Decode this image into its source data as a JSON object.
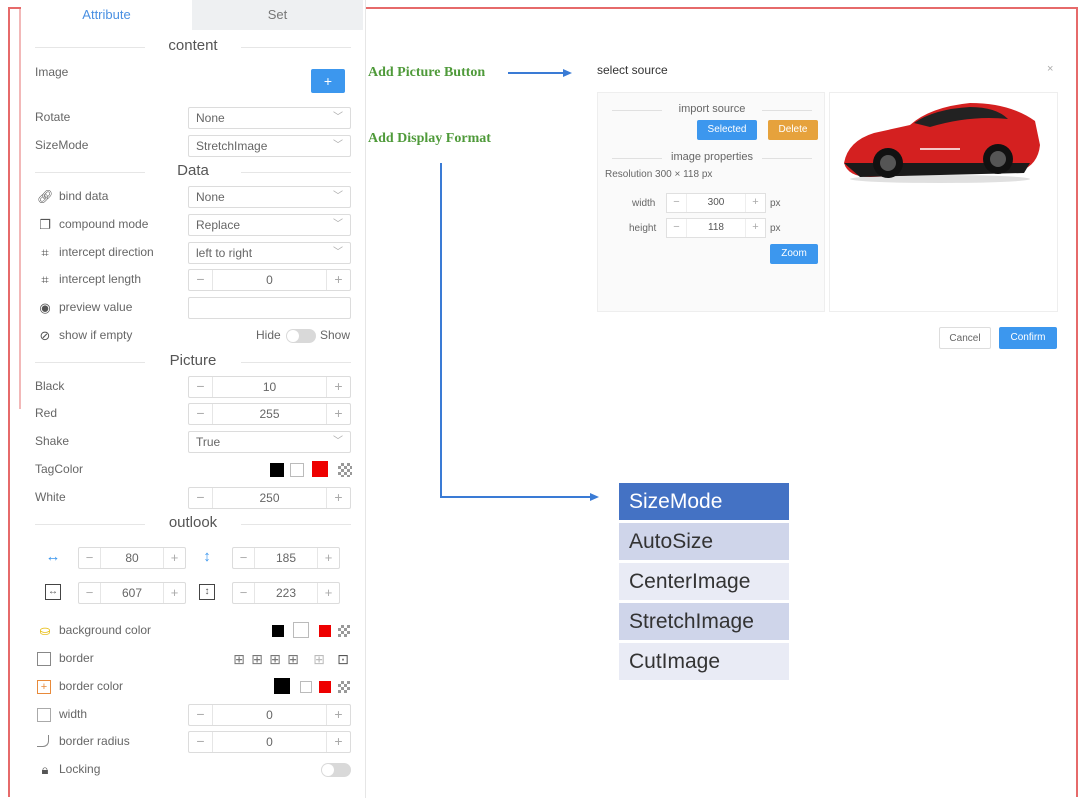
{
  "tabs": {
    "attribute": "Attribute",
    "set": "Set"
  },
  "sections": {
    "content": "content",
    "data": "Data",
    "picture": "Picture",
    "outlook": "outlook"
  },
  "content": {
    "image_label": "Image",
    "add_button": "+",
    "rotate_label": "Rotate",
    "rotate_value": "None",
    "sizemode_label": "SizeMode",
    "sizemode_value": "StretchImage"
  },
  "data": {
    "bind_label": "bind data",
    "bind_value": "None",
    "compound_label": "compound mode",
    "compound_value": "Replace",
    "intercept_dir_label": "intercept direction",
    "intercept_dir_value": "left to right",
    "intercept_len_label": "intercept length",
    "intercept_len_value": "0",
    "preview_label": "preview value",
    "show_empty_label": "show if empty",
    "hide": "Hide",
    "show": "Show"
  },
  "picture": {
    "black_label": "Black",
    "black_value": "10",
    "red_label": "Red",
    "red_value": "255",
    "shake_label": "Shake",
    "shake_value": "True",
    "tagcolor_label": "TagColor",
    "white_label": "White",
    "white_value": "250"
  },
  "outlook": {
    "x": "80",
    "y": "185",
    "w": "607",
    "h": "223",
    "bg_color_label": "background color",
    "border_label": "border",
    "border_color_label": "border color",
    "width_label": "width",
    "width_value": "0",
    "radius_label": "border radius",
    "radius_value": "0",
    "locking_label": "Locking"
  },
  "annotations": {
    "add_picture": "Add Picture Button",
    "add_display": "Add Display Format"
  },
  "dialog": {
    "title": "select source",
    "close": "×",
    "import_source": "import source",
    "selected": "Selected",
    "delete": "Delete",
    "image_properties": "image properties",
    "resolution": "Resolution 300 × 118 px",
    "width_label": "width",
    "width_value": "300",
    "height_label": "height",
    "height_value": "118",
    "unit": "px",
    "zoom": "Zoom",
    "cancel": "Cancel",
    "confirm": "Confirm"
  },
  "sizemode_list": [
    "SizeMode",
    "AutoSize",
    "CenterImage",
    "StretchImage",
    "CutImage"
  ],
  "colors": {
    "accent": "#3c97ee",
    "delete": "#e6a23c",
    "list_head": "#4472c4",
    "annotation": "#4f9a3a"
  }
}
